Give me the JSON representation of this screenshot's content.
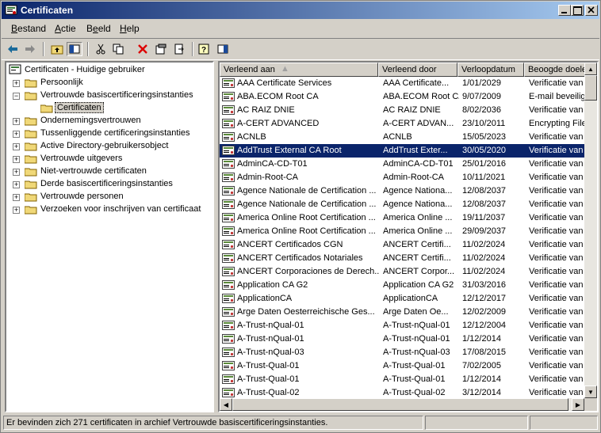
{
  "window": {
    "title": "Certificaten"
  },
  "menu": [
    {
      "label": "Bestand",
      "key": "B",
      "rest": "estand"
    },
    {
      "label": "Actie",
      "key": "A",
      "rest": "ctie"
    },
    {
      "label": "Beeld",
      "key": "e",
      "pre": "B",
      "rest": "eld"
    },
    {
      "label": "Help",
      "key": "H",
      "rest": "elp"
    }
  ],
  "toolbar": [
    "back-icon",
    "forward-icon",
    "up-folder-icon",
    "show-tree-icon",
    "cut-icon",
    "copy-icon",
    "delete-icon",
    "properties-icon",
    "export-icon",
    "help-icon",
    "details-pane-icon"
  ],
  "tree": {
    "root": "Certificaten - Huidige gebruiker",
    "items": [
      {
        "label": "Persoonlijk",
        "expanded": false
      },
      {
        "label": "Vertrouwde basiscertificeringsinstanties",
        "expanded": true
      },
      {
        "label": "Certificaten",
        "child": true,
        "selected": true
      },
      {
        "label": "Ondernemingsvertrouwen",
        "expanded": false
      },
      {
        "label": "Tussenliggende certificeringsinstanties",
        "expanded": false
      },
      {
        "label": "Active Directory-gebruikersobject",
        "expanded": false
      },
      {
        "label": "Vertrouwde uitgevers",
        "expanded": false
      },
      {
        "label": "Niet-vertrouwde certificaten",
        "expanded": false
      },
      {
        "label": "Derde basiscertificeringsinstanties",
        "expanded": false
      },
      {
        "label": "Vertrouwde personen",
        "expanded": false
      },
      {
        "label": "Verzoeken voor inschrijven van certificaat",
        "expanded": false
      }
    ]
  },
  "list": {
    "columns": [
      "Verleend aan",
      "Verleend door",
      "Verloopdatum",
      "Beoogde doele"
    ],
    "selected_index": 5,
    "rows": [
      [
        "AAA Certificate Services",
        "AAA Certificate...",
        "1/01/2029",
        "Verificatie van"
      ],
      [
        "ABA.ECOM Root CA",
        "ABA.ECOM Root CA",
        "9/07/2009",
        "E-mail beveilige"
      ],
      [
        "AC RAIZ DNIE",
        "AC RAIZ DNIE",
        "8/02/2036",
        "Verificatie van"
      ],
      [
        "A-CERT ADVANCED",
        "A-CERT ADVAN...",
        "23/10/2011",
        "Encrypting File"
      ],
      [
        "ACNLB",
        "ACNLB",
        "15/05/2023",
        "Verificatie van"
      ],
      [
        "AddTrust External CA Root",
        "AddTrust Exter...",
        "30/05/2020",
        "Verificatie van"
      ],
      [
        "AdminCA-CD-T01",
        "AdminCA-CD-T01",
        "25/01/2016",
        "Verificatie van"
      ],
      [
        "Admin-Root-CA",
        "Admin-Root-CA",
        "10/11/2021",
        "Verificatie van"
      ],
      [
        "Agence Nationale de Certification ...",
        "Agence Nationa...",
        "12/08/2037",
        "Verificatie van"
      ],
      [
        "Agence Nationale de Certification ...",
        "Agence Nationa...",
        "12/08/2037",
        "Verificatie van"
      ],
      [
        "America Online Root Certification ...",
        "America Online ...",
        "19/11/2037",
        "Verificatie van"
      ],
      [
        "America Online Root Certification ...",
        "America Online ...",
        "29/09/2037",
        "Verificatie van"
      ],
      [
        "ANCERT Certificados CGN",
        "ANCERT Certifi...",
        "11/02/2024",
        "Verificatie van"
      ],
      [
        "ANCERT Certificados Notariales",
        "ANCERT Certifi...",
        "11/02/2024",
        "Verificatie van"
      ],
      [
        "ANCERT Corporaciones de Derech...",
        "ANCERT Corpor...",
        "11/02/2024",
        "Verificatie van"
      ],
      [
        "Application CA G2",
        "Application CA G2",
        "31/03/2016",
        "Verificatie van"
      ],
      [
        "ApplicationCA",
        "ApplicationCA",
        "12/12/2017",
        "Verificatie van"
      ],
      [
        "Arge Daten Oesterreichische Ges...",
        "Arge Daten Oe...",
        "12/02/2009",
        "Verificatie van"
      ],
      [
        "A-Trust-nQual-01",
        "A-Trust-nQual-01",
        "12/12/2004",
        "Verificatie van"
      ],
      [
        "A-Trust-nQual-01",
        "A-Trust-nQual-01",
        "1/12/2014",
        "Verificatie van"
      ],
      [
        "A-Trust-nQual-03",
        "A-Trust-nQual-03",
        "17/08/2015",
        "Verificatie van"
      ],
      [
        "A-Trust-Qual-01",
        "A-Trust-Qual-01",
        "7/02/2005",
        "Verificatie van"
      ],
      [
        "A-Trust-Qual-01",
        "A-Trust-Qual-01",
        "1/12/2014",
        "Verificatie van"
      ],
      [
        "A-Trust-Qual-02",
        "A-Trust-Qual-02",
        "3/12/2014",
        "Verificatie van"
      ]
    ]
  },
  "status": {
    "text": "Er bevinden zich 271 certificaten in archief Vertrouwde basiscertificeringsinstanties."
  },
  "colors": {
    "selection": "#0a246a",
    "titlebar_start": "#0a246a",
    "titlebar_end": "#a6caf0",
    "face": "#d4d0c8"
  }
}
